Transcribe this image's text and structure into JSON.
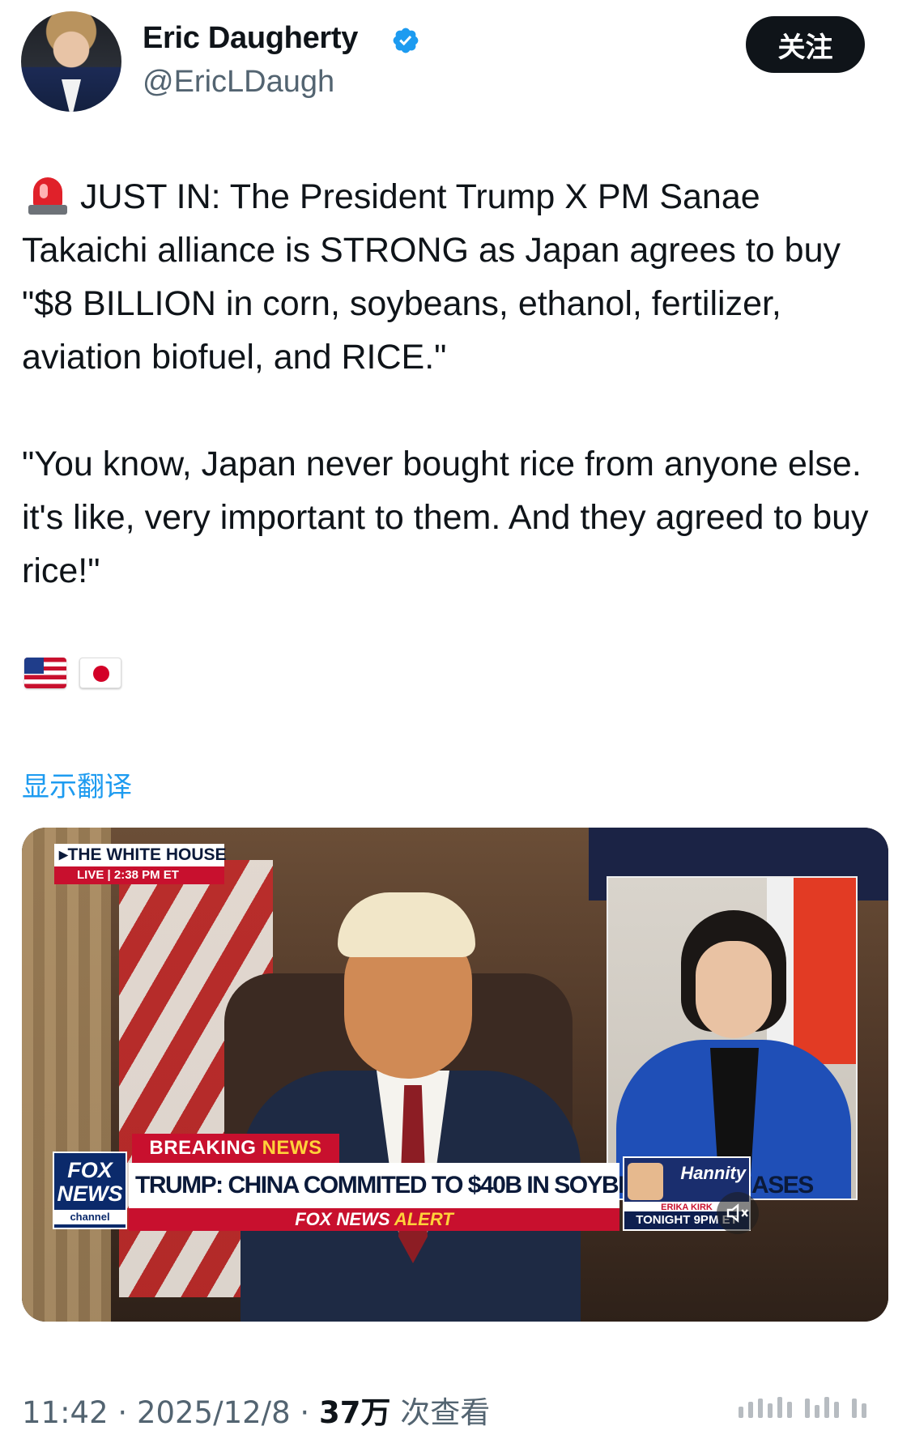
{
  "user": {
    "display_name": "Eric Daugherty",
    "handle": "@EricLDaugh",
    "verified": true,
    "avatar_icon": "profile-photo"
  },
  "follow_label": "关注",
  "tweet": {
    "paragraph1": "JUST IN: The President Trump X PM Sanae Takaichi alliance is STRONG as Japan agrees to buy \"$8 BILLION in corn, soybeans, ethanol, fertilizer, aviation biofuel, and RICE.\"",
    "paragraph2": "\"You know, Japan never bought rice from anyone else. it's like, very important to them. And they agreed to buy rice!\"",
    "lead_emoji": "rotating-light-icon",
    "flags": [
      "us-flag-icon",
      "japan-flag-icon"
    ]
  },
  "translate_label": "显示翻译",
  "video": {
    "location": "THE WHITE HOUSE",
    "live": "LIVE",
    "time": "2:38 PM ET",
    "breaking_a": "BREAKING ",
    "breaking_b": "NEWS",
    "headline": "TRUMP: CHINA COMMITED TO $40B IN SOYBEAN PURCHASES",
    "alert_a": "FOX NEWS ",
    "alert_b": "ALERT",
    "network_line1": "FOX",
    "network_line2": "NEWS",
    "network_line3": "channel",
    "promo_show": "Hannity",
    "promo_guest": "ERIKA KIRK",
    "promo_time": "TONIGHT 9PM ET",
    "muted": true
  },
  "meta": {
    "time": "11:42",
    "sep1": " · ",
    "date": "2025/12/8",
    "sep2": " · ",
    "views": "37万",
    "views_label": " 次查看"
  },
  "colors": {
    "accent": "#1d9bf0",
    "text": "#0f1419",
    "secondary": "#536471",
    "fox_red": "#c8102e",
    "fox_blue": "#0b2a6b"
  }
}
